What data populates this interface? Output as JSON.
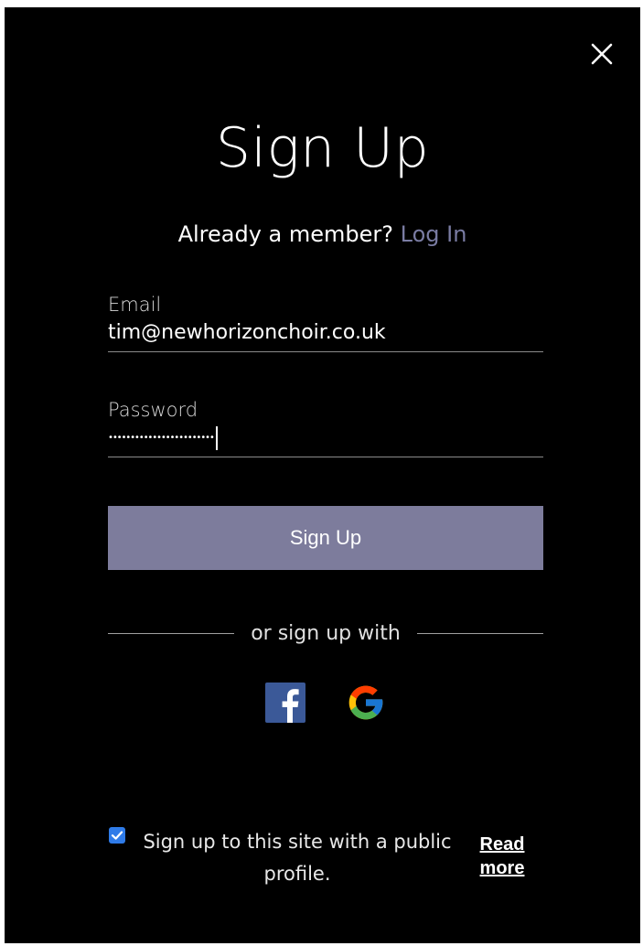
{
  "header": {
    "title": "Sign Up",
    "member_prompt": "Already a member?",
    "login_link": "Log In"
  },
  "form": {
    "email": {
      "label": "Email",
      "value": "tim@newhorizonchoir.co.uk"
    },
    "password": {
      "label": "Password",
      "masked_value": "••••••••••••••••••••••••"
    },
    "submit_label": "Sign Up"
  },
  "social": {
    "divider_text": "or sign up with",
    "providers": [
      "facebook-icon",
      "google-icon"
    ]
  },
  "consent": {
    "checked": true,
    "text": "Sign up to this site with a public profile.",
    "read_more_label": "Read more"
  },
  "colors": {
    "background": "#000000",
    "button": "#7d7c9c",
    "link": "#7a7ca3",
    "checkbox": "#2f7be8",
    "facebook": "#3b5998"
  }
}
